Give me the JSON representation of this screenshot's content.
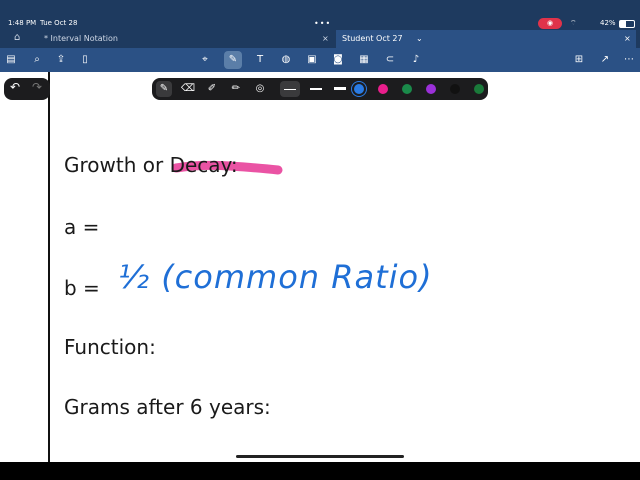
{
  "status_bar": {
    "time": "1:48 PM",
    "date": "Tue Oct 28",
    "dots": "•••",
    "battery": "42%"
  },
  "tabs": [
    {
      "label": "* Interval Notation",
      "active": false
    },
    {
      "label": "Student Oct 27",
      "active": true
    }
  ],
  "toolbar": {
    "icons_left": [
      "sidebar-icon",
      "search-icon",
      "share-icon",
      "bookmark-icon"
    ],
    "icons_center": [
      "lasso-icon",
      "pen-icon",
      "text-icon",
      "shape-icon",
      "image-icon",
      "camera-icon",
      "sticky-icon",
      "link-icon",
      "mic-icon"
    ],
    "icons_right": [
      "add-page-icon",
      "export-icon",
      "more-icon"
    ]
  },
  "pen_bar": {
    "colors": [
      "#2a7be4",
      "#e91e8c",
      "#1a8a4a",
      "#9b30d9",
      "#111111",
      "#1a7a3a"
    ],
    "selected_color": "#2a7be4"
  },
  "note": {
    "growth_or_decay": "Growth or Decay:",
    "a_label": "a =",
    "b_label": "b =",
    "b_handwritten": "½  (common Ratio)",
    "function_label": "Function:",
    "grams_label": "Grams after 6 years:"
  },
  "colors": {
    "highlight": "#e8409a",
    "ink": "#1f6fd6"
  }
}
